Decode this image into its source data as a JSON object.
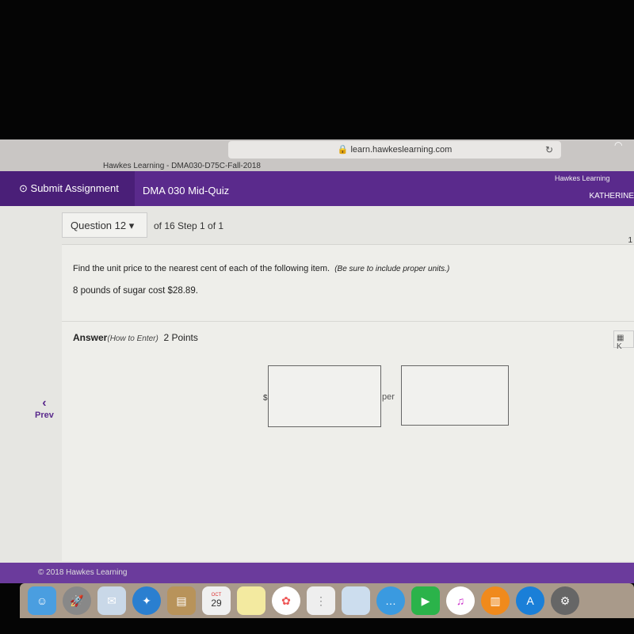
{
  "browser": {
    "url": "learn.hawkeslearning.com",
    "tab_title": "Hawkes Learning - DMA030-D75C-Fall-2018",
    "tab_right": "Hawkes Learning"
  },
  "topbar": {
    "submit_label": "Submit Assignment",
    "quiz_name": "DMA 030 Mid-Quiz",
    "user": "KATHERINE"
  },
  "question": {
    "selector": "Question 12",
    "of_text": "of 16 Step 1 of 1",
    "page_number": "1",
    "prompt": "Find the unit price to the nearest cent of each of the following item.",
    "prompt_note": "(Be sure to include proper units.)",
    "given": "8 pounds of sugar cost $28.89."
  },
  "answer": {
    "label": "Answer",
    "how_to": "(How to Enter)",
    "points": "2 Points",
    "dollar": "$",
    "per": "per",
    "price_value": "",
    "unit_value": "",
    "keypad_label": "K"
  },
  "nav": {
    "prev": "Prev"
  },
  "footer": {
    "copyright": "© 2018 Hawkes Learning"
  },
  "dock": {
    "calendar_month": "OCT",
    "calendar_day": "29",
    "icons": [
      "finder",
      "launchpad",
      "mail",
      "safari",
      "contacts",
      "calendar",
      "notes",
      "photos",
      "reminders",
      "maps",
      "messages",
      "facetime",
      "itunes",
      "ibooks",
      "app-store",
      "system-preferences"
    ]
  }
}
